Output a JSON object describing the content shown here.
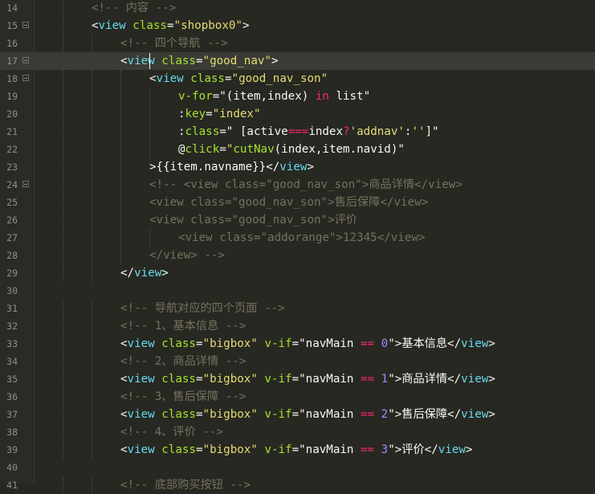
{
  "editor": {
    "active_line": 17,
    "lines": [
      {
        "n": "14",
        "fold": false,
        "indent": 2,
        "tokens": [
          [
            "t-comment",
            "<!-- 内容 -->"
          ]
        ]
      },
      {
        "n": "15",
        "fold": true,
        "indent": 2,
        "tokens": [
          [
            "t-punc",
            "<"
          ],
          [
            "t-tag",
            "view"
          ],
          [
            "t-punc",
            " "
          ],
          [
            "t-attr",
            "class"
          ],
          [
            "t-punc",
            "="
          ],
          [
            "t-str",
            "\"shopbox0\""
          ],
          [
            "t-punc",
            ">"
          ]
        ]
      },
      {
        "n": "16",
        "fold": false,
        "indent": 3,
        "tokens": [
          [
            "t-comment",
            "<!-- 四个导航 -->"
          ]
        ]
      },
      {
        "n": "17",
        "fold": true,
        "indent": 3,
        "tokens": [
          [
            "t-punc",
            "<"
          ],
          [
            "t-tag",
            "view"
          ],
          [
            "t-punc",
            " "
          ],
          [
            "t-attr",
            "class"
          ],
          [
            "t-punc",
            "="
          ],
          [
            "t-str",
            "\"good_nav\""
          ],
          [
            "t-punc",
            ">"
          ]
        ]
      },
      {
        "n": "18",
        "fold": true,
        "indent": 4,
        "tokens": [
          [
            "t-punc",
            "<"
          ],
          [
            "t-tag",
            "view"
          ],
          [
            "t-punc",
            " "
          ],
          [
            "t-attr",
            "class"
          ],
          [
            "t-punc",
            "="
          ],
          [
            "t-str",
            "\"good_nav_son\""
          ]
        ]
      },
      {
        "n": "19",
        "fold": false,
        "indent": 5,
        "tokens": [
          [
            "t-attr",
            "v-for"
          ],
          [
            "t-punc",
            "=\"(item,index) "
          ],
          [
            "t-kw",
            "in"
          ],
          [
            "t-punc",
            " list\""
          ]
        ]
      },
      {
        "n": "20",
        "fold": false,
        "indent": 5,
        "tokens": [
          [
            "t-punc",
            ":"
          ],
          [
            "t-attr",
            "key"
          ],
          [
            "t-punc",
            "="
          ],
          [
            "t-str",
            "\"index\""
          ]
        ]
      },
      {
        "n": "21",
        "fold": false,
        "indent": 5,
        "tokens": [
          [
            "t-punc",
            ":"
          ],
          [
            "t-attr",
            "class"
          ],
          [
            "t-punc",
            "=\" [active"
          ],
          [
            "t-ops",
            "==="
          ],
          [
            "t-punc",
            "index"
          ],
          [
            "t-ops",
            "?"
          ],
          [
            "t-str",
            "'addnav'"
          ],
          [
            "t-punc",
            ":"
          ],
          [
            "t-str",
            "''"
          ],
          [
            "t-punc",
            "]\""
          ]
        ]
      },
      {
        "n": "22",
        "fold": false,
        "indent": 5,
        "tokens": [
          [
            "t-punc",
            "@"
          ],
          [
            "t-attr",
            "click"
          ],
          [
            "t-punc",
            "="
          ],
          [
            "t-str",
            "\""
          ],
          [
            "t-fn",
            "cutNav"
          ],
          [
            "t-punc",
            "(index,item.navid)\""
          ]
        ]
      },
      {
        "n": "23",
        "fold": false,
        "indent": 4,
        "tokens": [
          [
            "t-punc",
            ">{{item.navname}}</"
          ],
          [
            "t-tag",
            "view"
          ],
          [
            "t-punc",
            ">"
          ]
        ]
      },
      {
        "n": "24",
        "fold": true,
        "indent": 4,
        "tokens": [
          [
            "t-comment",
            "<!-- <view class=\"good_nav_son\">商品详情</view>"
          ]
        ]
      },
      {
        "n": "25",
        "fold": false,
        "indent": 4,
        "tokens": [
          [
            "t-comment",
            "<view class=\"good_nav_son\">售后保障</view>"
          ]
        ]
      },
      {
        "n": "26",
        "fold": false,
        "indent": 4,
        "tokens": [
          [
            "t-comment",
            "<view class=\"good_nav_son\">评价"
          ]
        ]
      },
      {
        "n": "27",
        "fold": false,
        "indent": 5,
        "tokens": [
          [
            "t-comment",
            "<view class=\"addorange\">12345</view>"
          ]
        ]
      },
      {
        "n": "28",
        "fold": false,
        "indent": 4,
        "tokens": [
          [
            "t-comment",
            "</view> -->"
          ]
        ]
      },
      {
        "n": "29",
        "fold": false,
        "indent": 3,
        "tokens": [
          [
            "t-punc",
            "</"
          ],
          [
            "t-tag",
            "view"
          ],
          [
            "t-punc",
            ">"
          ]
        ]
      },
      {
        "n": "30",
        "fold": false,
        "indent": 0,
        "tokens": []
      },
      {
        "n": "31",
        "fold": false,
        "indent": 3,
        "tokens": [
          [
            "t-comment",
            "<!-- 导航对应的四个页面 -->"
          ]
        ]
      },
      {
        "n": "32",
        "fold": false,
        "indent": 3,
        "tokens": [
          [
            "t-comment",
            "<!-- 1、基本信息 -->"
          ]
        ]
      },
      {
        "n": "33",
        "fold": false,
        "indent": 3,
        "tokens": [
          [
            "t-punc",
            "<"
          ],
          [
            "t-tag",
            "view"
          ],
          [
            "t-punc",
            " "
          ],
          [
            "t-attr",
            "class"
          ],
          [
            "t-punc",
            "="
          ],
          [
            "t-str",
            "\"bigbox\""
          ],
          [
            "t-punc",
            " "
          ],
          [
            "t-attr",
            "v-if"
          ],
          [
            "t-punc",
            "=\"navMain "
          ],
          [
            "t-ops",
            "=="
          ],
          [
            "t-punc",
            " "
          ],
          [
            "t-num",
            "0"
          ],
          [
            "t-punc",
            "\">基本信息</"
          ],
          [
            "t-tag",
            "view"
          ],
          [
            "t-punc",
            ">"
          ]
        ]
      },
      {
        "n": "34",
        "fold": false,
        "indent": 3,
        "tokens": [
          [
            "t-comment",
            "<!-- 2、商品详情 -->"
          ]
        ]
      },
      {
        "n": "35",
        "fold": false,
        "indent": 3,
        "tokens": [
          [
            "t-punc",
            "<"
          ],
          [
            "t-tag",
            "view"
          ],
          [
            "t-punc",
            " "
          ],
          [
            "t-attr",
            "class"
          ],
          [
            "t-punc",
            "="
          ],
          [
            "t-str",
            "\"bigbox\""
          ],
          [
            "t-punc",
            " "
          ],
          [
            "t-attr",
            "v-if"
          ],
          [
            "t-punc",
            "=\"navMain "
          ],
          [
            "t-ops",
            "=="
          ],
          [
            "t-punc",
            " "
          ],
          [
            "t-num",
            "1"
          ],
          [
            "t-punc",
            "\">商品详情</"
          ],
          [
            "t-tag",
            "view"
          ],
          [
            "t-punc",
            ">"
          ]
        ]
      },
      {
        "n": "36",
        "fold": false,
        "indent": 3,
        "tokens": [
          [
            "t-comment",
            "<!-- 3、售后保障 -->"
          ]
        ]
      },
      {
        "n": "37",
        "fold": false,
        "indent": 3,
        "tokens": [
          [
            "t-punc",
            "<"
          ],
          [
            "t-tag",
            "view"
          ],
          [
            "t-punc",
            " "
          ],
          [
            "t-attr",
            "class"
          ],
          [
            "t-punc",
            "="
          ],
          [
            "t-str",
            "\"bigbox\""
          ],
          [
            "t-punc",
            " "
          ],
          [
            "t-attr",
            "v-if"
          ],
          [
            "t-punc",
            "=\"navMain "
          ],
          [
            "t-ops",
            "=="
          ],
          [
            "t-punc",
            " "
          ],
          [
            "t-num",
            "2"
          ],
          [
            "t-punc",
            "\">售后保障</"
          ],
          [
            "t-tag",
            "view"
          ],
          [
            "t-punc",
            ">"
          ]
        ]
      },
      {
        "n": "38",
        "fold": false,
        "indent": 3,
        "tokens": [
          [
            "t-comment",
            "<!-- 4、评价 -->"
          ]
        ]
      },
      {
        "n": "39",
        "fold": false,
        "indent": 3,
        "tokens": [
          [
            "t-punc",
            "<"
          ],
          [
            "t-tag",
            "view"
          ],
          [
            "t-punc",
            " "
          ],
          [
            "t-attr",
            "class"
          ],
          [
            "t-punc",
            "="
          ],
          [
            "t-str",
            "\"bigbox\""
          ],
          [
            "t-punc",
            " "
          ],
          [
            "t-attr",
            "v-if"
          ],
          [
            "t-punc",
            "=\"navMain "
          ],
          [
            "t-ops",
            "=="
          ],
          [
            "t-punc",
            " "
          ],
          [
            "t-num",
            "3"
          ],
          [
            "t-punc",
            "\">评价</"
          ],
          [
            "t-tag",
            "view"
          ],
          [
            "t-punc",
            ">"
          ]
        ]
      },
      {
        "n": "40",
        "fold": false,
        "indent": 0,
        "tokens": []
      },
      {
        "n": "41",
        "fold": false,
        "indent": 3,
        "tokens": [
          [
            "t-comment",
            "<!-- 底部购买按钮 -->"
          ]
        ]
      }
    ]
  }
}
